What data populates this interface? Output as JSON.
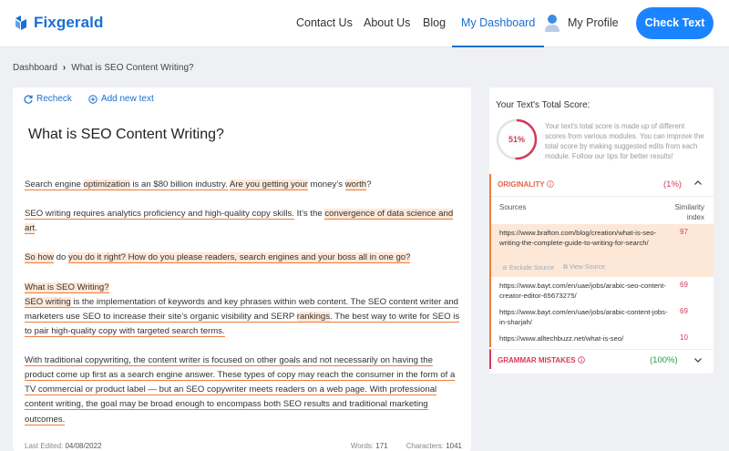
{
  "header": {
    "logo_text": "Fixgerald",
    "nav": [
      {
        "label": "Contact Us"
      },
      {
        "label": "About Us"
      },
      {
        "label": "Blog"
      },
      {
        "label": "My Dashboard",
        "active": true
      },
      {
        "label": "My Profile"
      }
    ],
    "cta_label": "Check Text",
    "accent": "#1a84ff"
  },
  "breadcrumb": {
    "root": "Dashboard",
    "current": "What is SEO Content Writing?"
  },
  "editor": {
    "toolbar": {
      "recheck": "Recheck",
      "add_new": "Add new text"
    },
    "title": "What is SEO Content Writing?",
    "paragraphs": {
      "p1": {
        "a": "Search engine ",
        "b": "optimization",
        "c": " ",
        "d": "is an $80 billion industry.",
        "e": " ",
        "f": "Are you getting your",
        "g": " money’s ",
        "h": "worth",
        "i": "?"
      },
      "p2": {
        "a": "SEO writing requires analytics proficiency and high-quality copy skills.",
        "b": " It’s the ",
        "c": "convergence of data science and art",
        "d": "."
      },
      "p3": {
        "a": "So how",
        "b": " do ",
        "c": "you do it right? How do you please readers, search engines and your boss all in one go?"
      },
      "p4": {
        "a": "What is SEO Writing?",
        "b": "SEO writing",
        "c": " is the implementation of keywords and key phrases within web content. The SEO content writer and marketers use SEO to increase their site’s organic visibility and SERP ",
        "d": "rankings",
        "e": ". The best way to write for SEO is to pair high-quality copy with targeted search terms."
      },
      "p5": {
        "a": "With traditional copywriting, the content writer is focused on other goals and not necessarily on having the product come up first as a search engine answer. These types of copy may reach the consumer in the form of a TV commercial or product label — but an SEO copywriter meets readers on a web page. With professional content writing, the goal may be broad enough to encompass both SEO results and traditional marketing outcomes."
      }
    },
    "meta": {
      "last_edited_label": "Last Edited:",
      "last_edited": "04/08/2022",
      "words_label": "Words:",
      "words": "171",
      "chars_label": "Characters:",
      "chars": "1041"
    }
  },
  "score_panel": {
    "title": "Your Text's Total Score:",
    "score": "51%",
    "score_fraction": 0.51,
    "description": "Your text's total score is made up of different scores from various modules. You can improve the total score by making suggested edits from each module. Follow our tips for better results!",
    "originality": {
      "label": "ORIGINALITY",
      "value": "(1%)",
      "col_sources": "Sources",
      "col_similarity": "Similarity index",
      "sources": [
        {
          "url": "https://www.brafton.com/blog/creation/what-is-seo-writing-the-complete-guide-to-writing-for-search/",
          "score": "97",
          "actions": [
            "Exclude Source",
            "View Source"
          ]
        },
        {
          "url": "https://www.bayt.com/en/uae/jobs/arabic-seo-content-creator-editor-65673275/",
          "score": "69"
        },
        {
          "url": "https://www.bayt.com/en/uae/jobs/arabic-content-jobs-in-sharjah/",
          "score": "69"
        },
        {
          "url": "https://www.alltechbuzz.net/what-is-seo/",
          "score": "10"
        }
      ]
    },
    "grammar": {
      "label": "GRAMMAR MISTAKES",
      "value": "(100%)"
    },
    "colors": {
      "originality": "#e2674e",
      "grammar": "#d6395a",
      "grammar_value": "#2e9a4c",
      "highlight": "#fde8d8"
    }
  }
}
